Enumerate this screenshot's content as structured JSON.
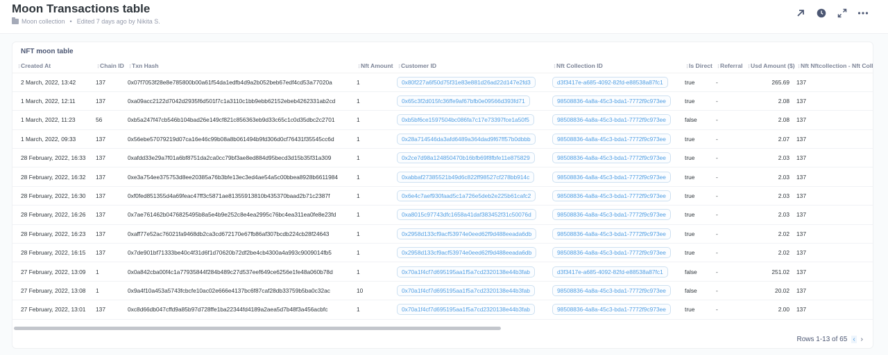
{
  "header": {
    "title": "Moon Transactions table",
    "collection": "Moon collection",
    "edited": "Edited 7 days ago by Nikita S."
  },
  "card": {
    "title": "NFT moon table",
    "columns": [
      "Created At",
      "Chain ID",
      "Txn Hash",
      "Nft Amount",
      "Customer ID",
      "Nft Collection ID",
      "Is Direct",
      "Referral",
      "Usd Amount ($)",
      "Nft Nftcollection - Nft Collec"
    ],
    "rows": [
      [
        "2 March, 2022, 13:42",
        "137",
        "0x07f7053f28e8e785800b00a61f54da1edfb4d9a2b052beb67edf4cd53a77020a",
        "1",
        "0x80f227a6f50d75f31e83e881d26ad22d147e2fd3",
        "d3f3417e-a685-4092-82fd-e88538a87fc1",
        "true",
        "-",
        "265.69",
        "137"
      ],
      [
        "1 March, 2022, 12:11",
        "137",
        "0xa09acc2122d7042d2935f6d501f7c1a3110c1bb9ebb62152ebeb4262331ab2cd",
        "1",
        "0x65c3f2d015fc36ffe9af67bfb0e09566d393fd71",
        "98508836-4a8a-45c3-bda1-7772f9c973ee",
        "true",
        "-",
        "2.08",
        "137"
      ],
      [
        "1 March, 2022, 11:23",
        "56",
        "0xb5a247f47cb546b104bad26e149cf821c856363eb9d33c65c1c0d35dbc2c2701",
        "1",
        "0xb5bf6ce1597504bc086fa7c17e73397fce1a50f5",
        "98508836-4a8a-45c3-bda1-7772f9c973ee",
        "false",
        "-",
        "2.08",
        "137"
      ],
      [
        "1 March, 2022, 09:33",
        "137",
        "0x56ebe57079219d07ca16e46c99b08a8b061494b9fd306d0cf76431f35545cc6d",
        "1",
        "0x28a714546da3afd6489a364dad9f67ff57b0dbbb",
        "98508836-4a8a-45c3-bda1-7772f9c973ee",
        "true",
        "-",
        "2.07",
        "137"
      ],
      [
        "28 February, 2022, 16:33",
        "137",
        "0xafdd33e29a7f01a6bf8751da2ca0cc79bf3ae8ed884d95becd3d15b35f31a309",
        "1",
        "0x2ce7d98a124850470b16bfb69f8fbfe11e875829",
        "98508836-4a8a-45c3-bda1-7772f9c973ee",
        "true",
        "-",
        "2.03",
        "137"
      ],
      [
        "28 February, 2022, 16:32",
        "137",
        "0xe3a754ee375753d8ee20385a76b3bfe13ec3ed4ae54a5c00bbea8928b6611984",
        "1",
        "0xabbaf27385521b49d6c822ff98527cf278bb914c",
        "98508836-4a8a-45c3-bda1-7772f9c973ee",
        "true",
        "-",
        "2.03",
        "137"
      ],
      [
        "28 February, 2022, 16:30",
        "137",
        "0xf0fed851355d4a69feac47ff3c5871ae81355913810b435370baad2b71c2387f",
        "1",
        "0x6e4c7aef930faad5c1a726e5deb2e225b61cafc2",
        "98508836-4a8a-45c3-bda1-7772f9c973ee",
        "true",
        "-",
        "2.03",
        "137"
      ],
      [
        "28 February, 2022, 16:26",
        "137",
        "0x7ae761462b0476825495b8a5e4b9e252c8e4ea2995c76bc4ea311ea0fe8e23fd",
        "1",
        "0xa8015c97743dfc1658a41daf383452f31c50076d",
        "98508836-4a8a-45c3-bda1-7772f9c973ee",
        "true",
        "-",
        "2.03",
        "137"
      ],
      [
        "28 February, 2022, 16:23",
        "137",
        "0xaff77e52ac76021fa9468db2ca3cd672170e67fb86af307bcdb224cb28f24643",
        "1",
        "0x2958d133cf9acf53974e0eed62f9d488eeada6db",
        "98508836-4a8a-45c3-bda1-7772f9c973ee",
        "true",
        "-",
        "2.02",
        "137"
      ],
      [
        "28 February, 2022, 16:15",
        "137",
        "0x7de901bf71333be40c4f31d6f1d70620b72df2be4cb4300a4a993c9009014fb5",
        "1",
        "0x2958d133cf9acf53974e0eed62f9d488eeada6db",
        "98508836-4a8a-45c3-bda1-7772f9c973ee",
        "true",
        "-",
        "2.02",
        "137"
      ],
      [
        "27 February, 2022, 13:09",
        "1",
        "0x0a842cba00f4c1a77935844f284b489c27d537eef649ce6256e1fe48a060b78d",
        "1",
        "0x70a1f4cf7d695195aa1f5a7cd2320138e44b3fab",
        "d3f3417e-a685-4092-82fd-e88538a87fc1",
        "false",
        "-",
        "251.02",
        "137"
      ],
      [
        "27 February, 2022, 13:08",
        "1",
        "0x9a4f10a453a5743fcbcfe10ac02e666e4137bc6f87caf28db33759b5ba0c32ac",
        "10",
        "0x70a1f4cf7d695195aa1f5a7cd2320138e44b3fab",
        "98508836-4a8a-45c3-bda1-7772f9c973ee",
        "false",
        "-",
        "20.02",
        "137"
      ],
      [
        "27 February, 2022, 13:01",
        "137",
        "0xc8d66db047cffd9a85b97d728ffe1ba22344fd4189a2aea5d7b48f3a456acbfc",
        "1",
        "0x70a1f4cf7d695195aa1f5a7cd2320138e44b3fab",
        "98508836-4a8a-45c3-bda1-7772f9c973ee",
        "true",
        "-",
        "2.00",
        "137"
      ]
    ],
    "pagination": "Rows 1-13 of 65"
  },
  "icons": {
    "folder": "folder-icon",
    "share": "arrow-up-right-icon",
    "history": "clock-icon",
    "fullscreen": "expand-icon",
    "more": "ellipsis-icon",
    "prev": "chevron-left-icon",
    "next": "chevron-right-icon"
  },
  "colors": {
    "link": "#509ee3",
    "text": "#2e353b",
    "muted": "#949aab"
  }
}
